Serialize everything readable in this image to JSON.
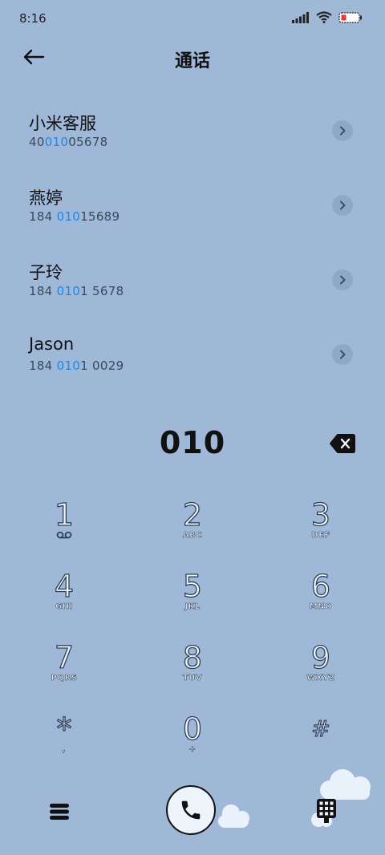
{
  "status": {
    "time": "8:16"
  },
  "header": {
    "title": "通话"
  },
  "contacts": [
    {
      "name": "小米客服",
      "number_pre": "40",
      "number_match": "010",
      "number_post": "05678"
    },
    {
      "name": "燕婷",
      "number_pre": "184 ",
      "number_match": "010",
      "number_post": "15689"
    },
    {
      "name": "子玲",
      "number_pre": "184 ",
      "number_match": "010",
      "number_post": "1 5678"
    },
    {
      "name": "Jason",
      "number_pre": "184 ",
      "number_match": "010",
      "number_post": "1 0029"
    }
  ],
  "dialer": {
    "entered": "010",
    "keys": [
      {
        "digit": "1",
        "letters": ""
      },
      {
        "digit": "2",
        "letters": "ABC"
      },
      {
        "digit": "3",
        "letters": "DEF"
      },
      {
        "digit": "4",
        "letters": "GHI"
      },
      {
        "digit": "5",
        "letters": "JKL"
      },
      {
        "digit": "6",
        "letters": "MNO"
      },
      {
        "digit": "7",
        "letters": "PQRS"
      },
      {
        "digit": "8",
        "letters": "TUV"
      },
      {
        "digit": "9",
        "letters": "WXYZ"
      },
      {
        "digit": "*",
        "letters": ","
      },
      {
        "digit": "0",
        "letters": "+"
      },
      {
        "digit": "#",
        "letters": ""
      }
    ]
  },
  "icons": {
    "back": "arrow-left-icon",
    "chevron": "chevron-right-icon",
    "backspace": "backspace-icon",
    "voicemail": "voicemail-icon",
    "menu": "menu-icon",
    "call": "phone-icon",
    "dialpad": "dialpad-icon"
  },
  "colors": {
    "background": "#9fb8d8",
    "highlight": "#1f86e6",
    "text": "#111111"
  }
}
